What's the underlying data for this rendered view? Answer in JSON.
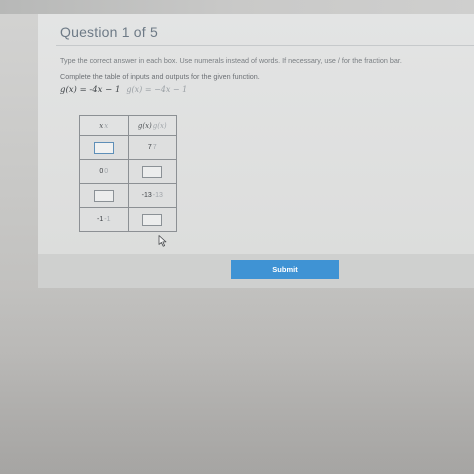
{
  "question": {
    "title": "Question 1 of 5"
  },
  "instruction": "Type the correct answer in each box. Use numerals instead of words. If necessary, use / for the fraction bar.",
  "prompt": "Complete the table of inputs and outputs for the given function.",
  "function": {
    "main": "g(x) = -4x − 1",
    "ghost": "g(x) = −4x − 1"
  },
  "table": {
    "header_x": "x",
    "header_x_ghost": "x",
    "header_g": "g(x)",
    "header_g_ghost": "g(x)",
    "rows": [
      {
        "x": "",
        "g": "7",
        "g_ghost": "7"
      },
      {
        "x": "0",
        "x_ghost": "0",
        "g": ""
      },
      {
        "x": "",
        "g": "-13",
        "g_ghost": "-13"
      },
      {
        "x": "-1",
        "x_ghost": "-1",
        "g": ""
      }
    ]
  },
  "submit_label": "Submit",
  "colors": {
    "accent": "#3f93d4",
    "title_text": "#6d7a86"
  },
  "icons": {
    "cursor": "mouse-pointer-icon"
  }
}
